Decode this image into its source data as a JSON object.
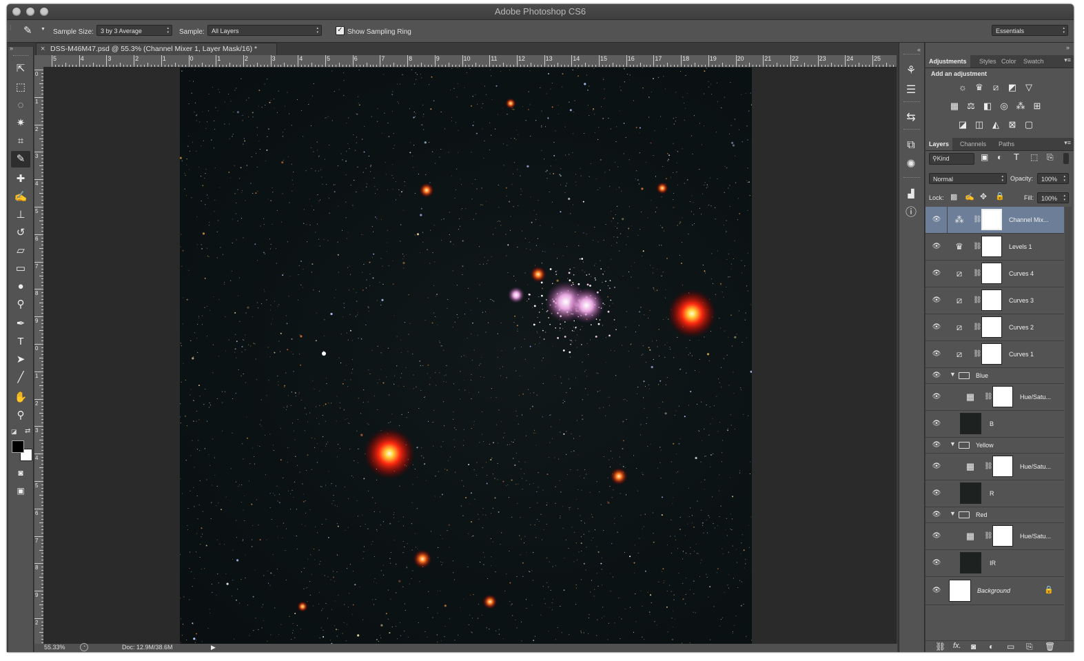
{
  "app": {
    "title": "Adobe Photoshop CS6"
  },
  "options_bar": {
    "sample_size_label": "Sample Size:",
    "sample_size_value": "3 by 3 Average",
    "sample_label": "Sample:",
    "sample_value": "All Layers",
    "show_ring_label": "Show Sampling Ring",
    "show_ring_checked": true,
    "workspace": "Essentials"
  },
  "document": {
    "tab_title": "DSS-M46M47.psd @ 55.3% (Channel Mixer 1, Layer Mask/16) *",
    "close_glyph": "×"
  },
  "rulers": {
    "horizontal_ticks": [
      "5",
      "4",
      "3",
      "2",
      "1",
      "0",
      "1",
      "2",
      "3",
      "4",
      "5",
      "6",
      "7",
      "8",
      "9",
      "10",
      "11",
      "12",
      "13",
      "14",
      "15",
      "16",
      "17",
      "18",
      "19",
      "20",
      "21",
      "22",
      "23",
      "24",
      "25"
    ],
    "vertical_ticks": [
      "0",
      "1",
      "2",
      "3",
      "4",
      "5",
      "6",
      "7",
      "8",
      "9",
      "0",
      "1",
      "2",
      "3",
      "4",
      "5",
      "6",
      "7",
      "8",
      "9",
      "2",
      "0"
    ]
  },
  "status": {
    "zoom": "55.33%",
    "doc_size": "Doc: 12.9M/38.6M"
  },
  "adjustments_panel": {
    "tabs": [
      "Adjustments",
      "Styles",
      "Color",
      "Swatch"
    ],
    "heading": "Add an adjustment",
    "icons": [
      "brightness-contrast",
      "levels",
      "curves",
      "exposure",
      "vibrance",
      "hue-saturation",
      "color-balance",
      "black-white",
      "photo-filter",
      "channel-mixer",
      "color-lookup",
      "invert",
      "posterize",
      "threshold",
      "gradient-map",
      "selective-color"
    ]
  },
  "layers_panel": {
    "tabs": [
      "Layers",
      "Channels",
      "Paths"
    ],
    "filter_kind": "Kind",
    "blend_mode": "Normal",
    "opacity_label": "Opacity:",
    "opacity_value": "100%",
    "lock_label": "Lock:",
    "fill_label": "Fill:",
    "fill_value": "100%",
    "layers": [
      {
        "name": "Channel Mix...",
        "type": "adjustment",
        "icon": "channel-mixer-icon",
        "selected": true
      },
      {
        "name": "Levels 1",
        "type": "adjustment",
        "icon": "levels-icon"
      },
      {
        "name": "Curves 4",
        "type": "adjustment",
        "icon": "curves-icon"
      },
      {
        "name": "Curves 3",
        "type": "adjustment",
        "icon": "curves-icon"
      },
      {
        "name": "Curves 2",
        "type": "adjustment",
        "icon": "curves-icon"
      },
      {
        "name": "Curves 1",
        "type": "adjustment",
        "icon": "curves-icon"
      },
      {
        "name": "Blue",
        "type": "group"
      },
      {
        "name": "Hue/Satu...",
        "type": "adjustment",
        "icon": "hue-saturation-icon",
        "indent": true
      },
      {
        "name": "B",
        "type": "pixel",
        "indent": true
      },
      {
        "name": "Yellow",
        "type": "group"
      },
      {
        "name": "Hue/Satu...",
        "type": "adjustment",
        "icon": "hue-saturation-icon",
        "indent": true
      },
      {
        "name": "R",
        "type": "pixel",
        "indent": true
      },
      {
        "name": "Red",
        "type": "group"
      },
      {
        "name": "Hue/Satu...",
        "type": "adjustment",
        "icon": "hue-saturation-icon",
        "indent": true
      },
      {
        "name": "IR",
        "type": "pixel",
        "indent": true
      },
      {
        "name": "Background",
        "type": "background",
        "locked": true
      }
    ]
  },
  "colors": {
    "accent_selection": "#6d7f98",
    "foreground": "#000000",
    "background": "#ffffff"
  }
}
